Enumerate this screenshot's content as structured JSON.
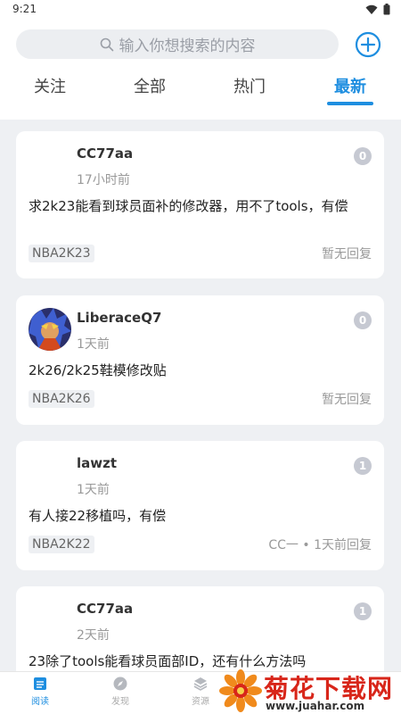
{
  "status_bar": {
    "time": "9:21"
  },
  "search": {
    "placeholder": "输入你想搜索的内容"
  },
  "tabs": [
    {
      "label": "关注"
    },
    {
      "label": "全部"
    },
    {
      "label": "热门"
    },
    {
      "label": "最新",
      "active": true
    }
  ],
  "posts": [
    {
      "username": "CC77aa",
      "time": "17小时前",
      "count": "0",
      "title": "求2k23能看到球员面补的修改器，用不了tools，有偿",
      "tag": "NBA2K23",
      "reply": "暂无回复",
      "has_avatar": false
    },
    {
      "username": "LiberaceQ7",
      "time": "1天前",
      "count": "0",
      "title": "2k26/2k25鞋模修改贴",
      "tag": "NBA2K26",
      "reply": "暂无回复",
      "has_avatar": true
    },
    {
      "username": "lawzt",
      "time": "1天前",
      "count": "1",
      "title": "有人接22移植吗，有偿",
      "tag": "NBA2K22",
      "reply": "CC一 • 1天前回复",
      "has_avatar": false
    },
    {
      "username": "CC77aa",
      "time": "2天前",
      "count": "1",
      "title": "23除了tools能看球员面部ID，还有什么方法吗",
      "tag": "",
      "reply": "",
      "has_avatar": false
    }
  ],
  "bottom_nav": [
    {
      "label": "阅读",
      "icon": "read-icon",
      "active": true
    },
    {
      "label": "发现",
      "icon": "compass-icon",
      "active": false
    },
    {
      "label": "资源",
      "icon": "layers-icon",
      "active": false
    }
  ],
  "watermark": {
    "title": "菊花下载网",
    "url": "www.juahar.com"
  },
  "colors": {
    "accent": "#1e8ee0",
    "badge": "#c6c9d2",
    "background": "#eef0f3"
  }
}
